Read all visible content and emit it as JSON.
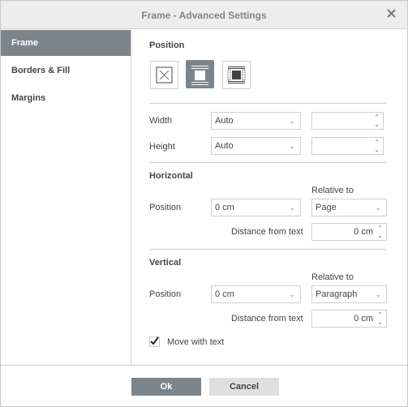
{
  "window": {
    "title": "Frame - Advanced Settings",
    "close_icon": "close-icon"
  },
  "sidebar": {
    "items": [
      {
        "label": "Frame",
        "active": true
      },
      {
        "label": "Borders & Fill",
        "active": false
      },
      {
        "label": "Margins",
        "active": false
      }
    ]
  },
  "position_section": {
    "header": "Position",
    "wrap_buttons": [
      {
        "name": "none",
        "icon": "frame-none-icon",
        "active": false
      },
      {
        "name": "inline",
        "icon": "frame-inline-icon",
        "active": true
      },
      {
        "name": "flow",
        "icon": "frame-flow-icon",
        "active": false
      }
    ]
  },
  "size": {
    "width_label": "Width",
    "width_value": "Auto",
    "width_spin_value": "",
    "height_label": "Height",
    "height_value": "Auto",
    "height_spin_value": ""
  },
  "horizontal": {
    "header": "Horizontal",
    "relative_label": "Relative to",
    "position_label": "Position",
    "position_value": "0 cm",
    "relative_value": "Page",
    "distance_label": "Distance from text",
    "distance_value": "0 cm"
  },
  "vertical": {
    "header": "Vertical",
    "relative_label": "Relative to",
    "position_label": "Position",
    "position_value": "0 cm",
    "relative_value": "Paragraph",
    "distance_label": "Distance from text",
    "distance_value": "0 cm",
    "move_with_text_label": "Move with text",
    "move_with_text_checked": true
  },
  "footer": {
    "ok_label": "Ok",
    "cancel_label": "Cancel"
  },
  "colors": {
    "accent": "#7d858c",
    "cancel_bg": "#dfdfdf",
    "titlebar_bg": "#ededed"
  }
}
